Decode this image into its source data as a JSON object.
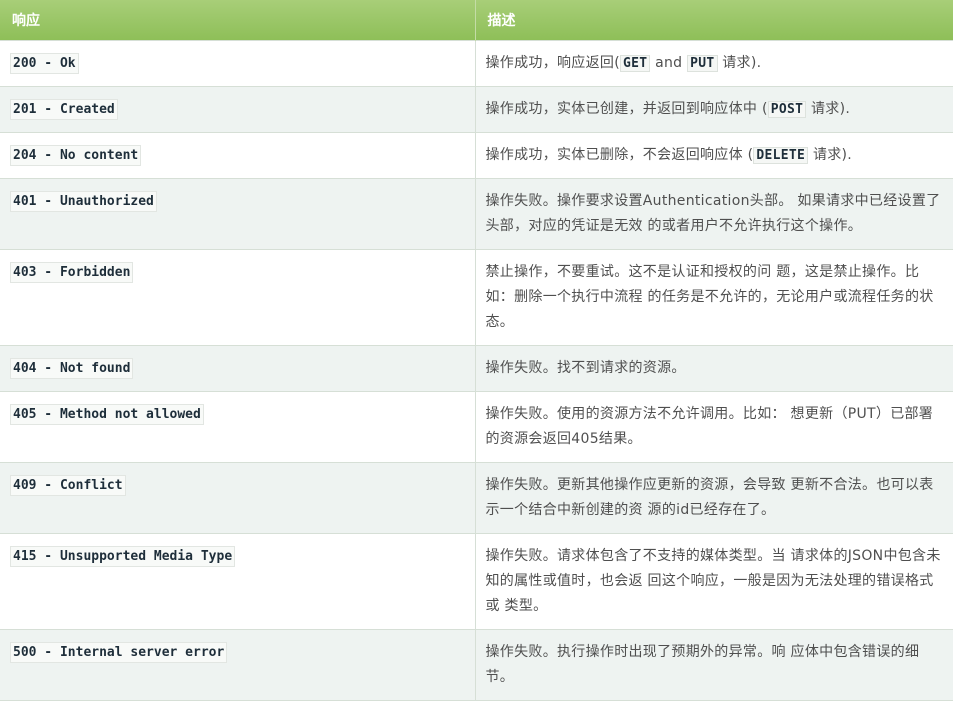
{
  "table": {
    "headers": {
      "response": "响应",
      "description": "描述"
    },
    "rows": [
      {
        "code": "200 - Ok",
        "desc": {
          "pre": "操作成功，响应返回(",
          "c1": "GET",
          "mid": " and ",
          "c2": "PUT",
          "post": " 请求)."
        }
      },
      {
        "code": "201 - Created",
        "desc": {
          "pre": "操作成功，实体已创建，并返回到响应体中 (",
          "c1": "POST",
          "post": " 请求)."
        }
      },
      {
        "code": "204 - No content",
        "desc": {
          "pre": "操作成功，实体已删除，不会返回响应体 (",
          "c1": "DELETE",
          "post": " 请求)."
        }
      },
      {
        "code": "401 - Unauthorized",
        "desc": {
          "text": "操作失败。操作要求设置Authentication头部。 如果请求中已经设置了头部，对应的凭证是无效 的或者用户不允许执行这个操作。"
        }
      },
      {
        "code": "403 - Forbidden",
        "desc": {
          "text": "禁止操作，不要重试。这不是认证和授权的问 题，这是禁止操作。比如：删除一个执行中流程 的任务是不允许的，无论用户或流程任务的状 态。"
        }
      },
      {
        "code": "404 - Not found",
        "desc": {
          "text": "操作失败。找不到请求的资源。"
        }
      },
      {
        "code": "405 - Method not allowed",
        "desc": {
          "text": "操作失败。使用的资源方法不允许调用。比如： 想更新（PUT）已部署的资源会返回405结果。"
        }
      },
      {
        "code": "409 - Conflict",
        "desc": {
          "text": "操作失败。更新其他操作应更新的资源，会导致 更新不合法。也可以表示一个结合中新创建的资 源的id已经存在了。"
        }
      },
      {
        "code": "415 - Unsupported Media Type",
        "desc": {
          "text": "操作失败。请求体包含了不支持的媒体类型。当 请求体的JSON中包含未知的属性或值时，也会返 回这个响应，一般是因为无法处理的错误格式或 类型。"
        }
      },
      {
        "code": "500 - Internal server error",
        "desc": {
          "text": "操作失败。执行操作时出现了预期外的异常。响 应体中包含错误的细节。"
        }
      }
    ]
  }
}
